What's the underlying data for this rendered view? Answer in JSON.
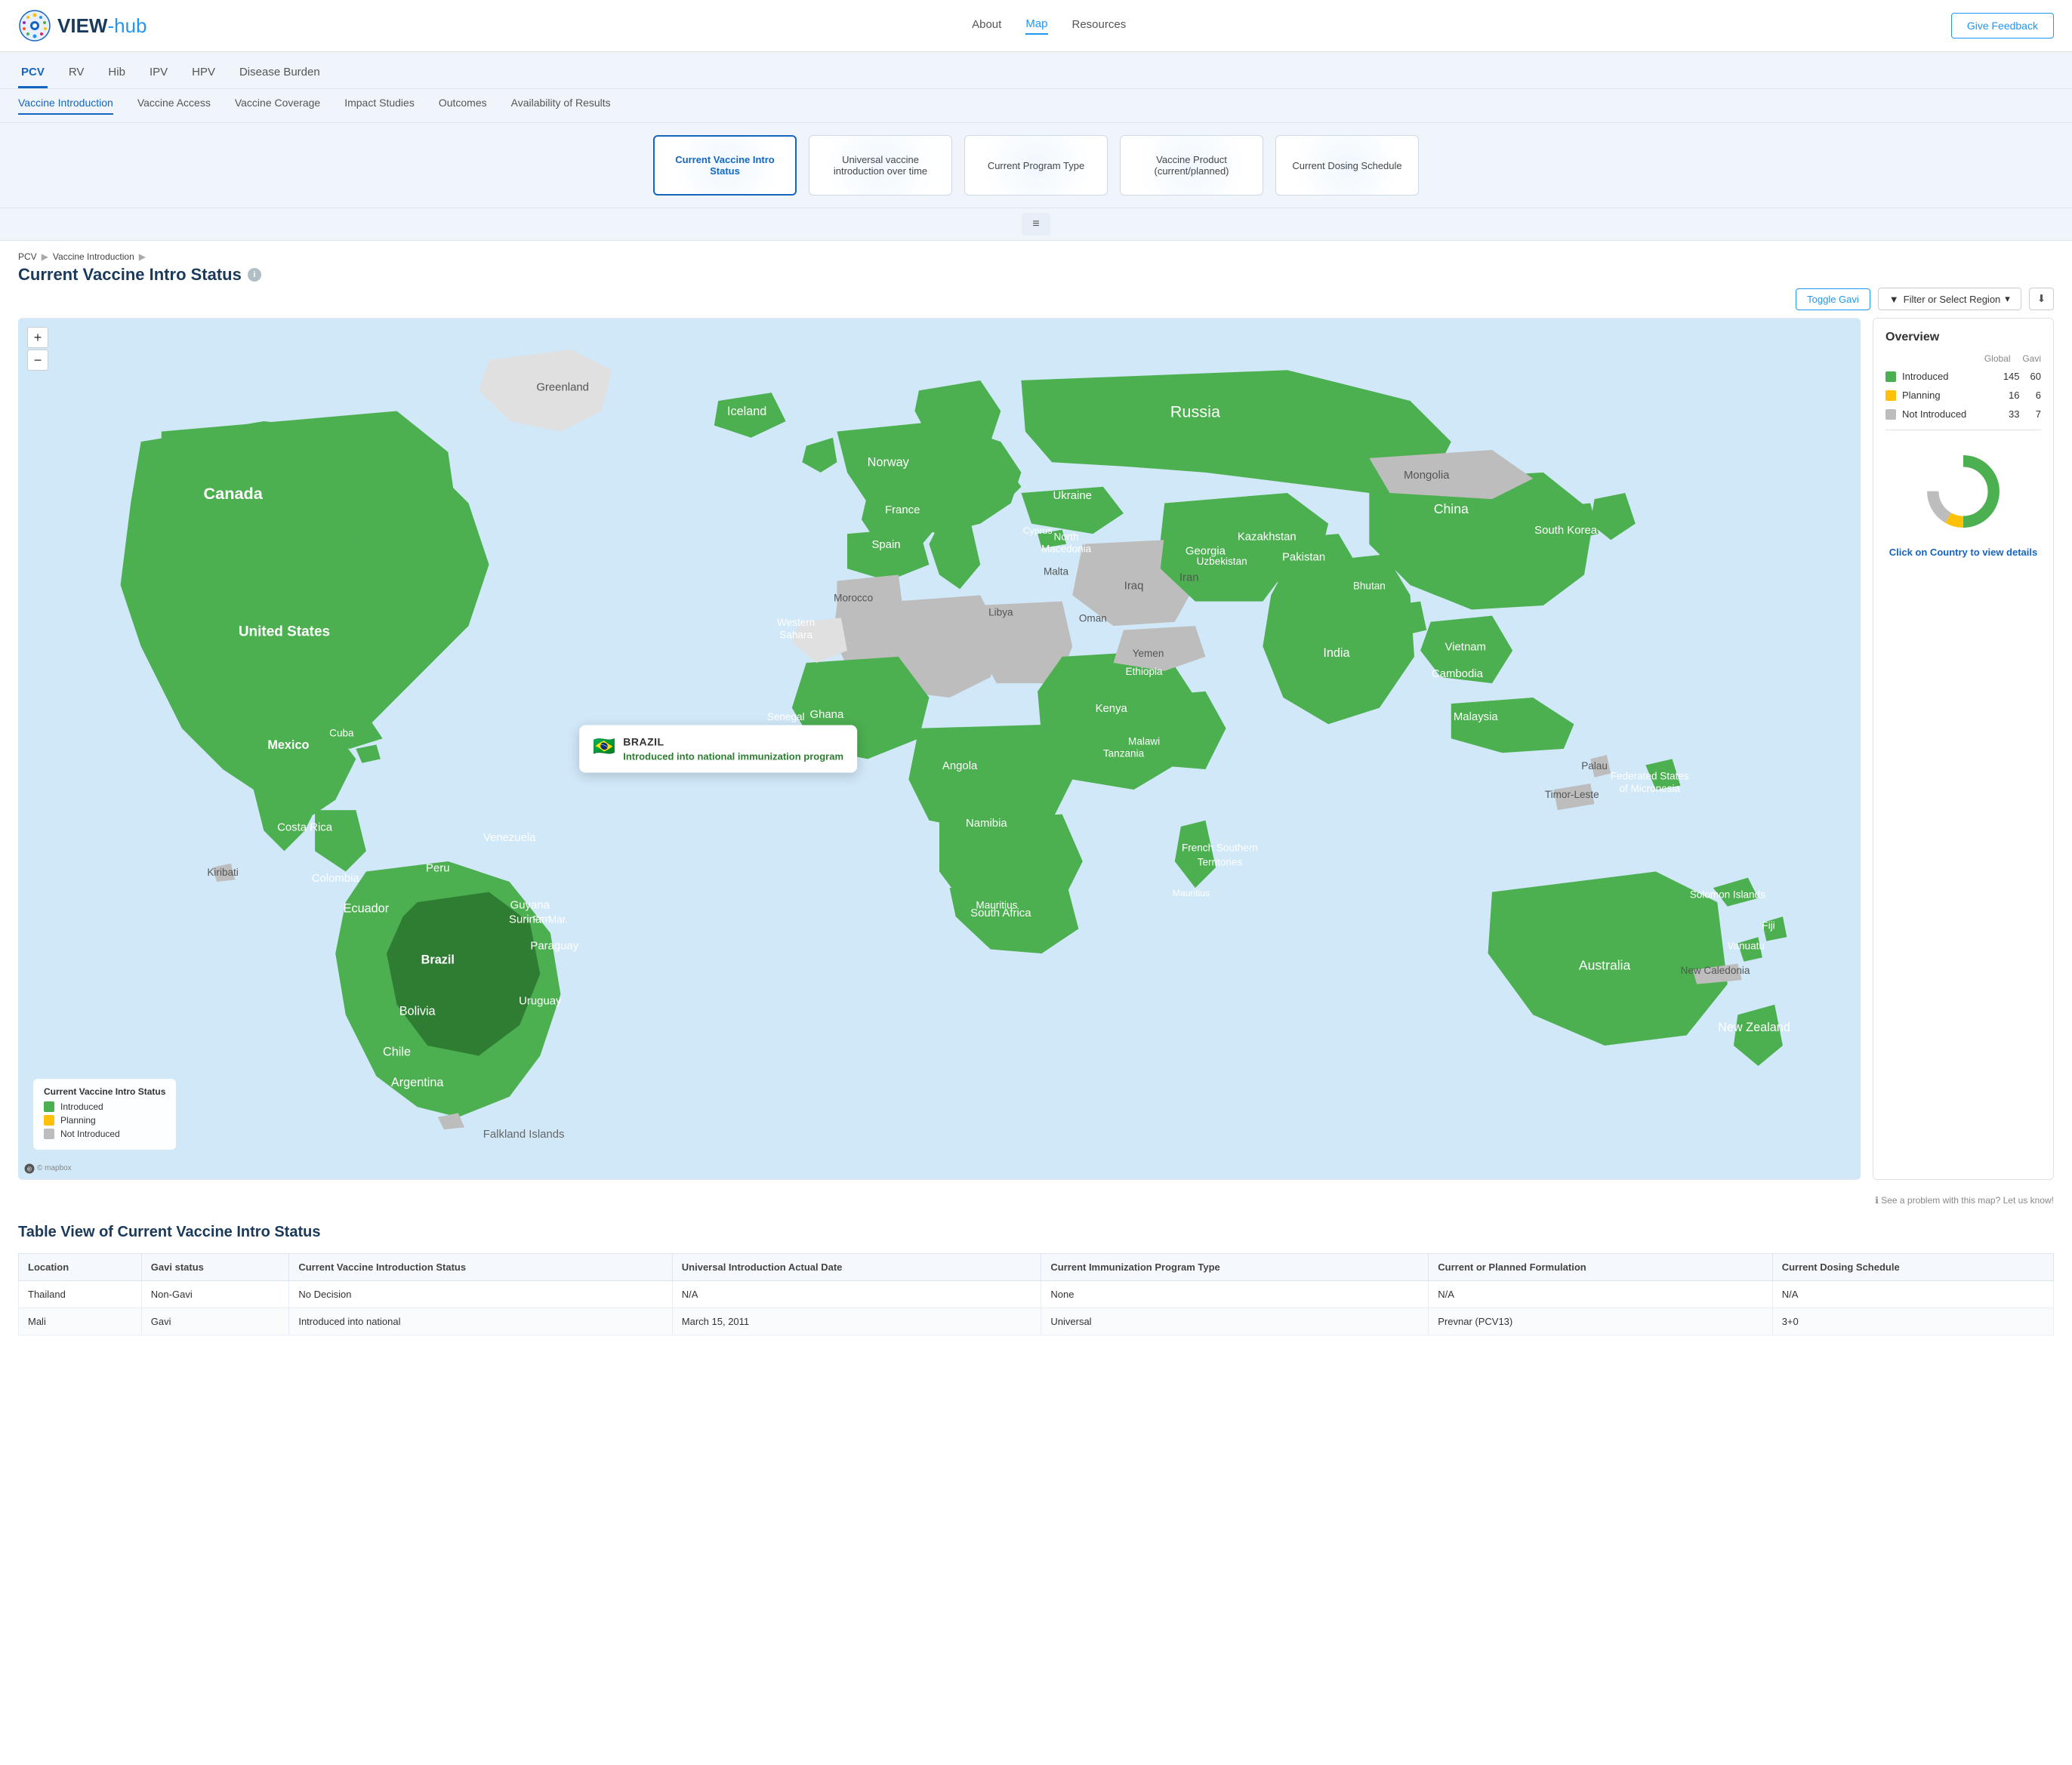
{
  "header": {
    "logo_text": "VIEW-hub",
    "logo_hub": "-hub",
    "nav_items": [
      "About",
      "Map",
      "Resources"
    ],
    "active_nav": "Map",
    "feedback_label": "Give Feedback"
  },
  "vaccine_tabs": [
    "PCV",
    "RV",
    "Hib",
    "IPV",
    "HPV",
    "Disease Burden"
  ],
  "active_vaccine": "PCV",
  "sub_tabs": [
    "Vaccine Introduction",
    "Vaccine Access",
    "Vaccine Coverage",
    "Impact Studies",
    "Outcomes",
    "Availability of Results"
  ],
  "active_sub_tab": "Vaccine Introduction",
  "view_cards": [
    {
      "id": "current-intro",
      "label": "Current Vaccine Intro Status",
      "active": true
    },
    {
      "id": "universal-intro",
      "label": "Universal vaccine introduction over time",
      "active": false
    },
    {
      "id": "program-type",
      "label": "Current Program Type",
      "active": false
    },
    {
      "id": "vaccine-product",
      "label": "Vaccine Product (current/planned)",
      "active": false
    },
    {
      "id": "dosing-schedule",
      "label": "Current Dosing Schedule",
      "active": false
    }
  ],
  "breadcrumb": {
    "parts": [
      "PCV",
      "Vaccine Introduction"
    ],
    "separator": "▶"
  },
  "page_title": "Current Vaccine Intro Status",
  "controls": {
    "toggle_gavi": "Toggle Gavi",
    "filter_label": "Filter or Select Region",
    "download_icon": "⬇"
  },
  "map": {
    "brazil_popup": {
      "flag": "🇧🇷",
      "country": "BRAZIL",
      "status": "Introduced into national immunization program"
    }
  },
  "legend": {
    "title": "Current Vaccine Intro Status",
    "items": [
      {
        "label": "Introduced",
        "color": "#4CAF50"
      },
      {
        "label": "Planning",
        "color": "#FFC107"
      },
      {
        "label": "Not Introduced",
        "color": "#BDBDBD"
      }
    ]
  },
  "overview": {
    "title": "Overview",
    "col_global": "Global",
    "col_gavi": "Gavi",
    "rows": [
      {
        "label": "Introduced",
        "color": "#4CAF50",
        "global": "145",
        "gavi": "60"
      },
      {
        "label": "Planning",
        "color": "#FFC107",
        "global": "16",
        "gavi": "6"
      },
      {
        "label": "Not Introduced",
        "color": "#BDBDBD",
        "global": "33",
        "gavi": "7"
      }
    ],
    "click_hint": "Click on Country to view details"
  },
  "donut": {
    "introduced_pct": 75,
    "planning_pct": 8,
    "not_introduced_pct": 17,
    "colors": {
      "introduced": "#4CAF50",
      "planning": "#FFC107",
      "not_introduced": "#BDBDBD"
    }
  },
  "map_problem_text": "See a problem with this map? Let us know!",
  "table": {
    "title": "Table View of Current Vaccine Intro Status",
    "columns": [
      "Location",
      "Gavi status",
      "Current Vaccine Introduction Status",
      "Universal Introduction Actual Date",
      "Current Immunization Program Type",
      "Current or Planned Formulation",
      "Current Dosing Schedule"
    ],
    "rows": [
      {
        "location": "Thailand",
        "gavi": "Non-Gavi",
        "intro_status": "No Decision",
        "intro_date": "N/A",
        "program_type": "None",
        "formulation": "N/A",
        "dosing": "N/A"
      },
      {
        "location": "Mali",
        "gavi": "Gavi",
        "intro_status": "Introduced into national",
        "intro_date": "March 15, 2011",
        "program_type": "Universal",
        "formulation": "Prevnar (PCV13)",
        "dosing": "3+0"
      }
    ]
  },
  "mapbox_credit": "© mapbox"
}
